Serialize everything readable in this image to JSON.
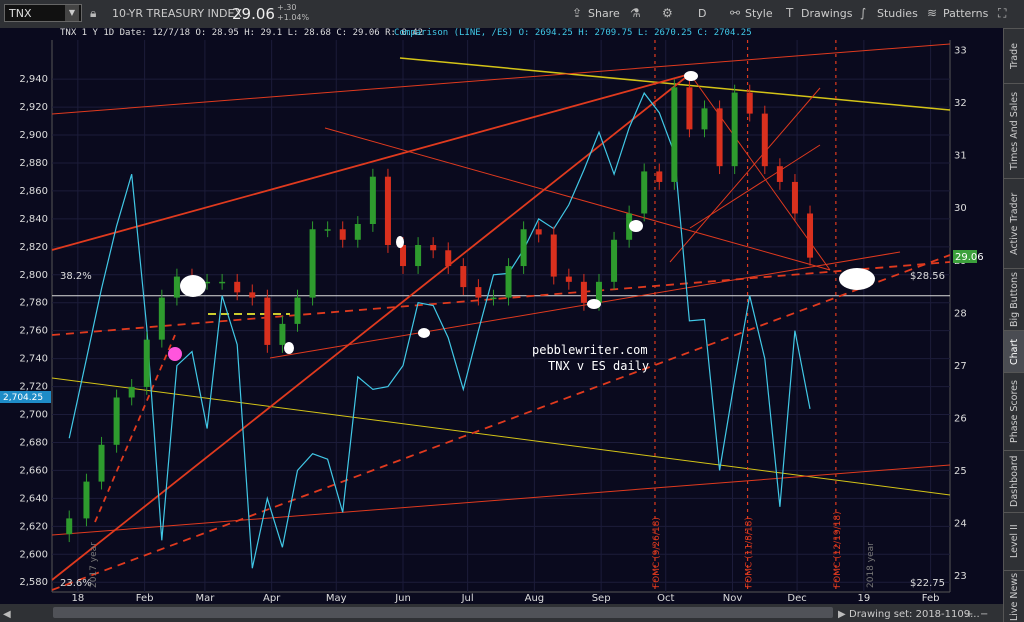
{
  "toolbar": {
    "symbol": "TNX",
    "instrument_name": "10-YR TREASURY INDEX",
    "last_price": "29.06",
    "change_abs": "+.30",
    "change_pct": "+1.04%",
    "share_label": "Share",
    "interval_label": "D",
    "style_label": "Style",
    "drawings_label": "Drawings",
    "studies_label": "Studies",
    "patterns_label": "Patterns"
  },
  "header_info": {
    "ohlc": "TNX 1 Y 1D  Date: 12/7/18  O: 28.95  H: 29.1  L: 28.68  C: 29.06  R: 0.42",
    "comparison": "Comparison (LINE, /ES)  O: 2694.25  H: 2709.75  L: 2670.25  C: 2704.25"
  },
  "sidebar_tabs": [
    "Trade",
    "Times And Sales",
    "Active Trader",
    "Big Buttons",
    "Chart",
    "Phase Scores",
    "Dashboard",
    "Level II",
    "Live News"
  ],
  "annotations": {
    "watermark_line1": "pebblewriter.com",
    "watermark_line2": "TNX v ES daily",
    "fib_382": "38.2%",
    "fib_236": "23.6%",
    "price_tag_right": "$28.56",
    "price_tag_bottom": "$22.75",
    "current_badge": "29.06",
    "es_badge": "2,704.25",
    "year_2017": "2017 year",
    "year_2018": "2018 year",
    "fomc": [
      "FOMC (9/26/18)",
      "FOMC (11/8/18)",
      "FOMC (12/19/18)"
    ],
    "drawing_set": "Drawing set: 2018-1109..."
  },
  "colors": {
    "background": "#0a0a1e",
    "tnx_up": "#2e9b2e",
    "tnx_down": "#d9301e",
    "es_line": "#41c8e6",
    "trendline_red": "#e03a1e",
    "trendline_yellow": "#d4c417",
    "fib_line": "#dcdcdc"
  },
  "chart_data": {
    "type": "line",
    "title": "",
    "xlabel": "",
    "ylabel": "",
    "x_tick_labels": [
      "18",
      "Feb",
      "Mar",
      "Apr",
      "May",
      "Jun",
      "Jul",
      "Aug",
      "Sep",
      "Oct",
      "Nov",
      "Dec",
      "19",
      "Feb"
    ],
    "left_axis": {
      "label": "/ES",
      "ticks": [
        2580,
        2600,
        2620,
        2640,
        2660,
        2680,
        2700,
        2720,
        2740,
        2760,
        2780,
        2800,
        2820,
        2840,
        2860,
        2880,
        2900,
        2920,
        2940
      ],
      "range": [
        2573,
        2968
      ]
    },
    "right_axis": {
      "label": "TNX",
      "ticks": [
        23,
        24,
        25,
        26,
        27,
        28,
        29,
        30,
        31,
        32,
        33
      ],
      "range": [
        22.7,
        33.2
      ]
    },
    "series": [
      {
        "name": "TNX",
        "kind": "candlestick",
        "axis": "right",
        "points": [
          [
            "2017-12-28",
            24.1
          ],
          [
            "2018-01-05",
            24.8
          ],
          [
            "2018-01-12",
            25.5
          ],
          [
            "2018-01-19",
            26.4
          ],
          [
            "2018-01-26",
            26.6
          ],
          [
            "2018-02-02",
            27.5
          ],
          [
            "2018-02-09",
            28.3
          ],
          [
            "2018-02-16",
            28.7
          ],
          [
            "2018-02-23",
            28.6
          ],
          [
            "2018-03-02",
            28.6
          ],
          [
            "2018-03-09",
            28.6
          ],
          [
            "2018-03-16",
            28.4
          ],
          [
            "2018-03-23",
            28.3
          ],
          [
            "2018-03-30",
            27.4
          ],
          [
            "2018-04-06",
            27.8
          ],
          [
            "2018-04-13",
            28.3
          ],
          [
            "2018-04-20",
            29.6
          ],
          [
            "2018-04-27",
            29.6
          ],
          [
            "2018-05-04",
            29.4
          ],
          [
            "2018-05-11",
            29.7
          ],
          [
            "2018-05-18",
            30.6
          ],
          [
            "2018-05-25",
            29.3
          ],
          [
            "2018-06-01",
            28.9
          ],
          [
            "2018-06-08",
            29.3
          ],
          [
            "2018-06-15",
            29.2
          ],
          [
            "2018-06-22",
            28.9
          ],
          [
            "2018-06-29",
            28.5
          ],
          [
            "2018-07-06",
            28.3
          ],
          [
            "2018-07-13",
            28.3
          ],
          [
            "2018-07-20",
            28.9
          ],
          [
            "2018-07-27",
            29.6
          ],
          [
            "2018-08-03",
            29.5
          ],
          [
            "2018-08-10",
            28.7
          ],
          [
            "2018-08-17",
            28.6
          ],
          [
            "2018-08-24",
            28.2
          ],
          [
            "2018-08-31",
            28.6
          ],
          [
            "2018-09-07",
            29.4
          ],
          [
            "2018-09-14",
            29.9
          ],
          [
            "2018-09-21",
            30.7
          ],
          [
            "2018-09-28",
            30.5
          ],
          [
            "2018-10-05",
            32.3
          ],
          [
            "2018-10-12",
            31.5
          ],
          [
            "2018-10-19",
            31.9
          ],
          [
            "2018-10-26",
            30.8
          ],
          [
            "2018-11-02",
            32.2
          ],
          [
            "2018-11-09",
            31.8
          ],
          [
            "2018-11-16",
            30.8
          ],
          [
            "2018-11-23",
            30.5
          ],
          [
            "2018-11-30",
            29.9
          ],
          [
            "2018-12-07",
            29.06
          ]
        ]
      },
      {
        "name": "/ES",
        "kind": "line",
        "axis": "left",
        "points": [
          [
            "2017-12-28",
            2683
          ],
          [
            "2018-01-05",
            2740
          ],
          [
            "2018-01-12",
            2790
          ],
          [
            "2018-01-19",
            2835
          ],
          [
            "2018-01-26",
            2872
          ],
          [
            "2018-02-02",
            2762
          ],
          [
            "2018-02-09",
            2610
          ],
          [
            "2018-02-16",
            2735
          ],
          [
            "2018-02-23",
            2745
          ],
          [
            "2018-03-02",
            2690
          ],
          [
            "2018-03-09",
            2785
          ],
          [
            "2018-03-16",
            2750
          ],
          [
            "2018-03-23",
            2590
          ],
          [
            "2018-03-30",
            2640
          ],
          [
            "2018-04-06",
            2605
          ],
          [
            "2018-04-13",
            2660
          ],
          [
            "2018-04-20",
            2672
          ],
          [
            "2018-04-27",
            2668
          ],
          [
            "2018-05-04",
            2630
          ],
          [
            "2018-05-11",
            2727
          ],
          [
            "2018-05-18",
            2718
          ],
          [
            "2018-05-25",
            2720
          ],
          [
            "2018-06-01",
            2735
          ],
          [
            "2018-06-08",
            2780
          ],
          [
            "2018-06-15",
            2778
          ],
          [
            "2018-06-22",
            2755
          ],
          [
            "2018-06-29",
            2718
          ],
          [
            "2018-07-06",
            2760
          ],
          [
            "2018-07-13",
            2800
          ],
          [
            "2018-07-20",
            2801
          ],
          [
            "2018-07-27",
            2818
          ],
          [
            "2018-08-03",
            2840
          ],
          [
            "2018-08-10",
            2833
          ],
          [
            "2018-08-17",
            2850
          ],
          [
            "2018-08-24",
            2875
          ],
          [
            "2018-08-31",
            2902
          ],
          [
            "2018-09-07",
            2872
          ],
          [
            "2018-09-14",
            2905
          ],
          [
            "2018-09-21",
            2930
          ],
          [
            "2018-09-28",
            2916
          ],
          [
            "2018-10-05",
            2887
          ],
          [
            "2018-10-12",
            2767
          ],
          [
            "2018-10-19",
            2768
          ],
          [
            "2018-10-26",
            2660
          ],
          [
            "2018-11-02",
            2725
          ],
          [
            "2018-11-09",
            2785
          ],
          [
            "2018-11-16",
            2740
          ],
          [
            "2018-11-23",
            2634
          ],
          [
            "2018-11-30",
            2760
          ],
          [
            "2018-12-07",
            2704
          ]
        ]
      }
    ],
    "horizontal_lines": [
      {
        "label": "38.2%",
        "value": 2785
      }
    ],
    "vertical_markers": [
      {
        "label": "FOMC (9/26/18)",
        "date": "2018-09-26"
      },
      {
        "label": "FOMC (11/8/18)",
        "date": "2018-11-08"
      },
      {
        "label": "FOMC (12/19/18)",
        "date": "2018-12-19"
      }
    ],
    "grid": true,
    "legend": "none"
  }
}
